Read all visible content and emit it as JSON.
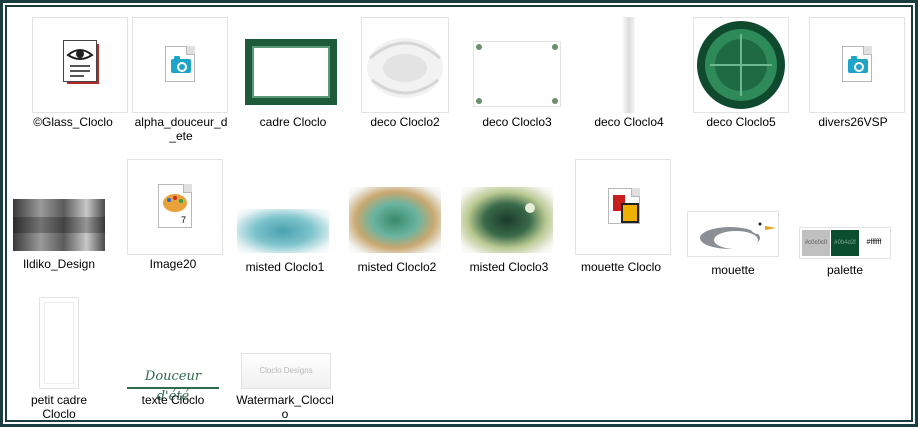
{
  "files": [
    {
      "key": "glass_cloclo",
      "name": "©Glass_Cloclo",
      "icon": "eye-document-icon"
    },
    {
      "key": "alpha",
      "name": "alpha_douceur_d\n_ete",
      "icon": "image-file-icon"
    },
    {
      "key": "cadre",
      "name": "cadre Cloclo",
      "icon": "thumbnail"
    },
    {
      "key": "deco2",
      "name": "deco Cloclo2",
      "icon": "thumbnail"
    },
    {
      "key": "deco3",
      "name": "deco Cloclo3",
      "icon": "thumbnail"
    },
    {
      "key": "deco4",
      "name": "deco Cloclo4",
      "icon": "thumbnail"
    },
    {
      "key": "deco5",
      "name": "deco Cloclo5",
      "icon": "thumbnail"
    },
    {
      "key": "divers",
      "name": "divers26VSP",
      "icon": "image-file-icon"
    },
    {
      "key": "ildiko",
      "name": "Ildiko_Design",
      "icon": "thumbnail"
    },
    {
      "key": "image20",
      "name": "Image20",
      "icon": "paint-palette-icon"
    },
    {
      "key": "misted1",
      "name": "misted Cloclo1",
      "icon": "thumbnail"
    },
    {
      "key": "misted2",
      "name": "misted Cloclo2",
      "icon": "thumbnail"
    },
    {
      "key": "misted3",
      "name": "misted Cloclo3",
      "icon": "thumbnail"
    },
    {
      "key": "mouette_cloclo",
      "name": "mouette Cloclo",
      "icon": "animation-file-icon"
    },
    {
      "key": "mouette",
      "name": "mouette",
      "icon": "thumbnail"
    },
    {
      "key": "palette",
      "name": "palette",
      "icon": "thumbnail"
    },
    {
      "key": "petit_cadre",
      "name": "petit cadre\nCloclo",
      "icon": "thumbnail"
    },
    {
      "key": "texte",
      "name": "texte Cloclo",
      "icon": "thumbnail"
    },
    {
      "key": "watermark",
      "name": "Watermark_Cloccl\no",
      "icon": "thumbnail"
    }
  ],
  "palette_swatches": [
    {
      "label": "#c0c0c0",
      "color": "#c0c0c0",
      "text_color": "#555555"
    },
    {
      "label": "#0b4d2f",
      "color": "#0b4d2f",
      "text_color": "#7fa890"
    },
    {
      "label": "#ffffff",
      "color": "#ffffff",
      "text_color": "#000000"
    }
  ],
  "thumb_text": {
    "texte": "Douceur d'été",
    "watermark": "Cloclo Designs"
  },
  "colors": {
    "frame": "#1a3d40",
    "green_frame": "#1d5a3a",
    "deco5_outer": "#0f4a2e",
    "deco5_mid": "#2f8a5a"
  }
}
